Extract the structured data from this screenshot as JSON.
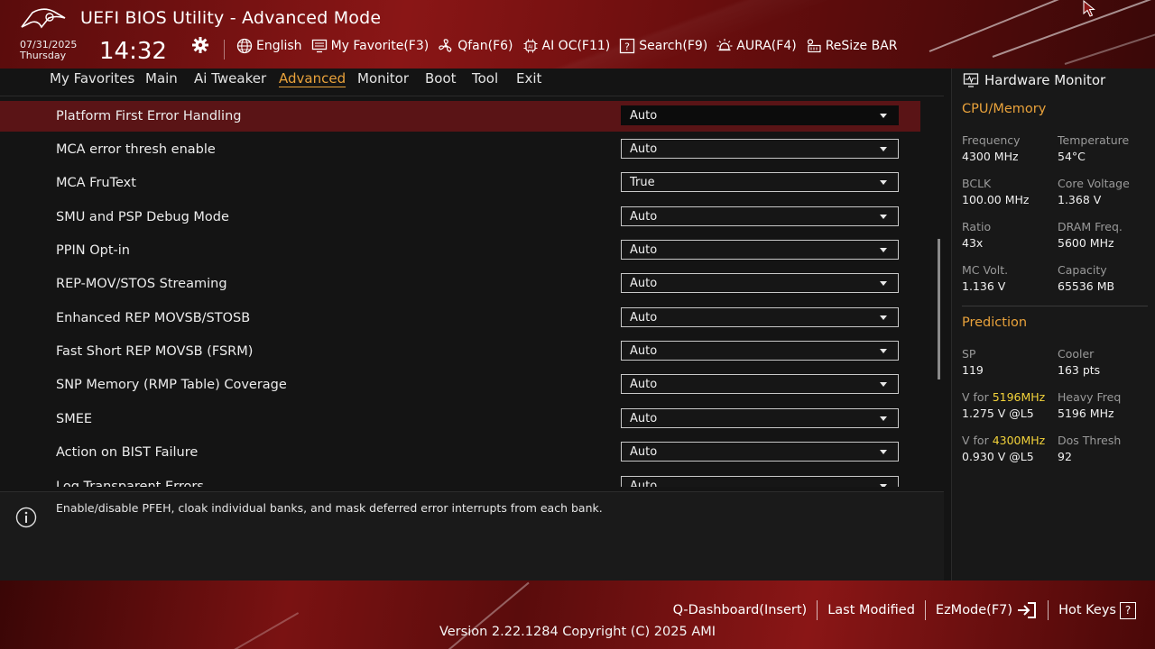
{
  "header": {
    "title": "UEFI BIOS Utility - Advanced Mode",
    "date": "07/31/2025",
    "day": "Thursday",
    "time": "14:32",
    "toolbar": [
      {
        "label": "English",
        "icon": "globe-icon"
      },
      {
        "label": "My Favorite(F3)",
        "icon": "favorite-monitor-icon"
      },
      {
        "label": "Qfan(F6)",
        "icon": "fan-icon"
      },
      {
        "label": "AI OC(F11)",
        "icon": "ai-chip-icon"
      },
      {
        "label": "Search(F9)",
        "icon": "search-box-icon"
      },
      {
        "label": "AURA(F4)",
        "icon": "aura-light-icon"
      },
      {
        "label": "ReSize BAR",
        "icon": "resize-bar-icon"
      }
    ]
  },
  "tabs": [
    {
      "label": "My Favorites",
      "active": false
    },
    {
      "label": "Main",
      "active": false
    },
    {
      "label": "Ai Tweaker",
      "active": false
    },
    {
      "label": "Advanced",
      "active": true
    },
    {
      "label": "Monitor",
      "active": false
    },
    {
      "label": "Boot",
      "active": false
    },
    {
      "label": "Tool",
      "active": false
    },
    {
      "label": "Exit",
      "active": false
    }
  ],
  "settings": [
    {
      "label": "Platform First Error Handling",
      "value": "Auto",
      "selected": true
    },
    {
      "label": "MCA error thresh enable",
      "value": "Auto"
    },
    {
      "label": "MCA FruText",
      "value": "True"
    },
    {
      "label": "SMU and PSP Debug Mode",
      "value": "Auto"
    },
    {
      "label": "PPIN Opt-in",
      "value": "Auto"
    },
    {
      "label": "REP-MOV/STOS Streaming",
      "value": "Auto"
    },
    {
      "label": "Enhanced REP MOVSB/STOSB",
      "value": "Auto"
    },
    {
      "label": "Fast Short REP MOVSB (FSRM)",
      "value": "Auto"
    },
    {
      "label": "SNP Memory (RMP Table) Coverage",
      "value": "Auto"
    },
    {
      "label": "SMEE",
      "value": "Auto"
    },
    {
      "label": "Action on BIST Failure",
      "value": "Auto"
    },
    {
      "label": "Log Transparent Errors",
      "value": "Auto"
    }
  ],
  "help": {
    "text": "Enable/disable PFEH, cloak individual banks, and mask deferred error interrupts from each bank."
  },
  "hardware_monitor": {
    "title": "Hardware Monitor",
    "cpu_memory": {
      "heading": "CPU/Memory",
      "items": [
        {
          "label": "Frequency",
          "value": "4300 MHz"
        },
        {
          "label": "Temperature",
          "value": "54°C"
        },
        {
          "label": "BCLK",
          "value": "100.00 MHz"
        },
        {
          "label": "Core Voltage",
          "value": "1.368 V"
        },
        {
          "label": "Ratio",
          "value": "43x"
        },
        {
          "label": "DRAM Freq.",
          "value": "5600 MHz"
        },
        {
          "label": "MC Volt.",
          "value": "1.136 V"
        },
        {
          "label": "Capacity",
          "value": "65536 MB"
        }
      ]
    },
    "prediction": {
      "heading": "Prediction",
      "sp_label": "SP",
      "sp_value": "119",
      "cooler_label": "Cooler",
      "cooler_value": "163 pts",
      "v1_prefix": "V for ",
      "v1_freq": "5196MHz",
      "v1_value": "1.275 V @L5",
      "heavy_label": "Heavy Freq",
      "heavy_value": "5196 MHz",
      "v2_prefix": "V for ",
      "v2_freq": "4300MHz",
      "v2_value": "0.930 V @L5",
      "dos_label": "Dos Thresh",
      "dos_value": "92"
    }
  },
  "footer": {
    "q_dashboard": "Q-Dashboard(Insert)",
    "last_modified": "Last Modified",
    "ezmode": "EzMode(F7)",
    "hot_keys": "Hot Keys",
    "hot_keys_box": "?",
    "version": "Version 2.22.1284 Copyright (C) 2025 AMI"
  },
  "colors": {
    "accent": "#e9a23b",
    "highlight": "#f2d23a",
    "selected_row": "#5a1416",
    "header_red": "#8a1616"
  }
}
